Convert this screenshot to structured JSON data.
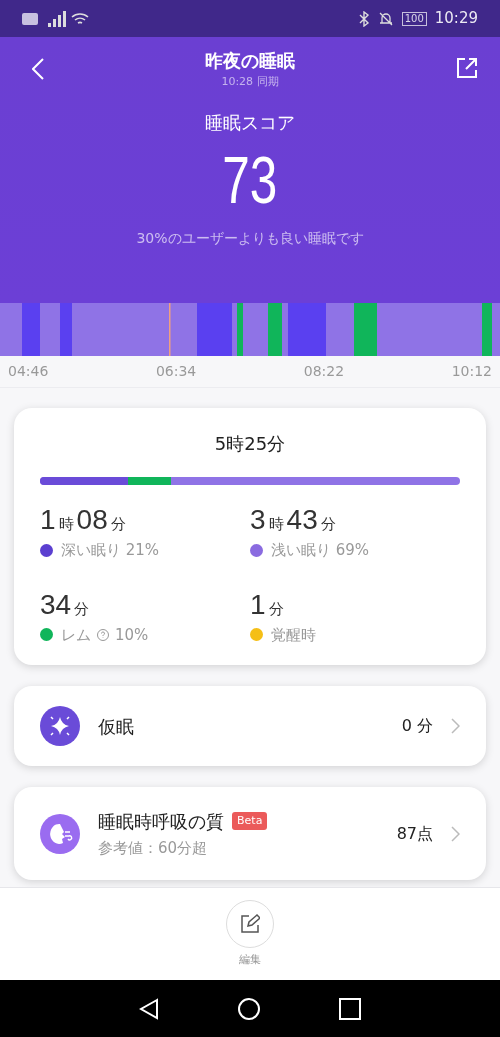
{
  "status_bar": {
    "time": "10:29",
    "battery": "100"
  },
  "header": {
    "title": "昨夜の睡眠",
    "subtitle": "10:28 同期",
    "score_label": "睡眠スコア",
    "score": "73",
    "comparison": "30%のユーザーよりも良い睡眠です"
  },
  "timeline": {
    "labels": [
      "04:46",
      "06:34",
      "08:22",
      "10:12"
    ]
  },
  "summary": {
    "total": "5時25分",
    "stats": [
      {
        "parts": [
          {
            "kind": "number",
            "text": "1"
          },
          {
            "kind": "unit",
            "text": "時"
          },
          {
            "kind": "number",
            "text": "08"
          },
          {
            "kind": "unit",
            "text": "分"
          }
        ],
        "label": "深い眠り 21%",
        "color": "#5b3fd0",
        "help": false
      },
      {
        "parts": [
          {
            "kind": "number",
            "text": "3"
          },
          {
            "kind": "unit",
            "text": "時"
          },
          {
            "kind": "number",
            "text": "43"
          },
          {
            "kind": "unit",
            "text": "分"
          }
        ],
        "label": "浅い眠り 69%",
        "color": "#8a6be0",
        "help": false
      },
      {
        "parts": [
          {
            "kind": "number",
            "text": "34"
          },
          {
            "kind": "unit",
            "text": "分"
          }
        ],
        "label": "レム",
        "extra": "10%",
        "color": "#10b55a",
        "help": true
      },
      {
        "parts": [
          {
            "kind": "number",
            "text": "1"
          },
          {
            "kind": "unit",
            "text": "分"
          }
        ],
        "label": "覚醒時",
        "color": "#f5bf16",
        "help": false
      }
    ]
  },
  "cards": [
    {
      "kind": "nap",
      "title": "仮眠",
      "value": "0 分"
    },
    {
      "kind": "breathing",
      "title": "睡眠時呼吸の質",
      "badge": "Beta",
      "subtitle": "参考値：60分超",
      "value": "87点"
    }
  ],
  "footer": {
    "edit_label": "編集"
  }
}
